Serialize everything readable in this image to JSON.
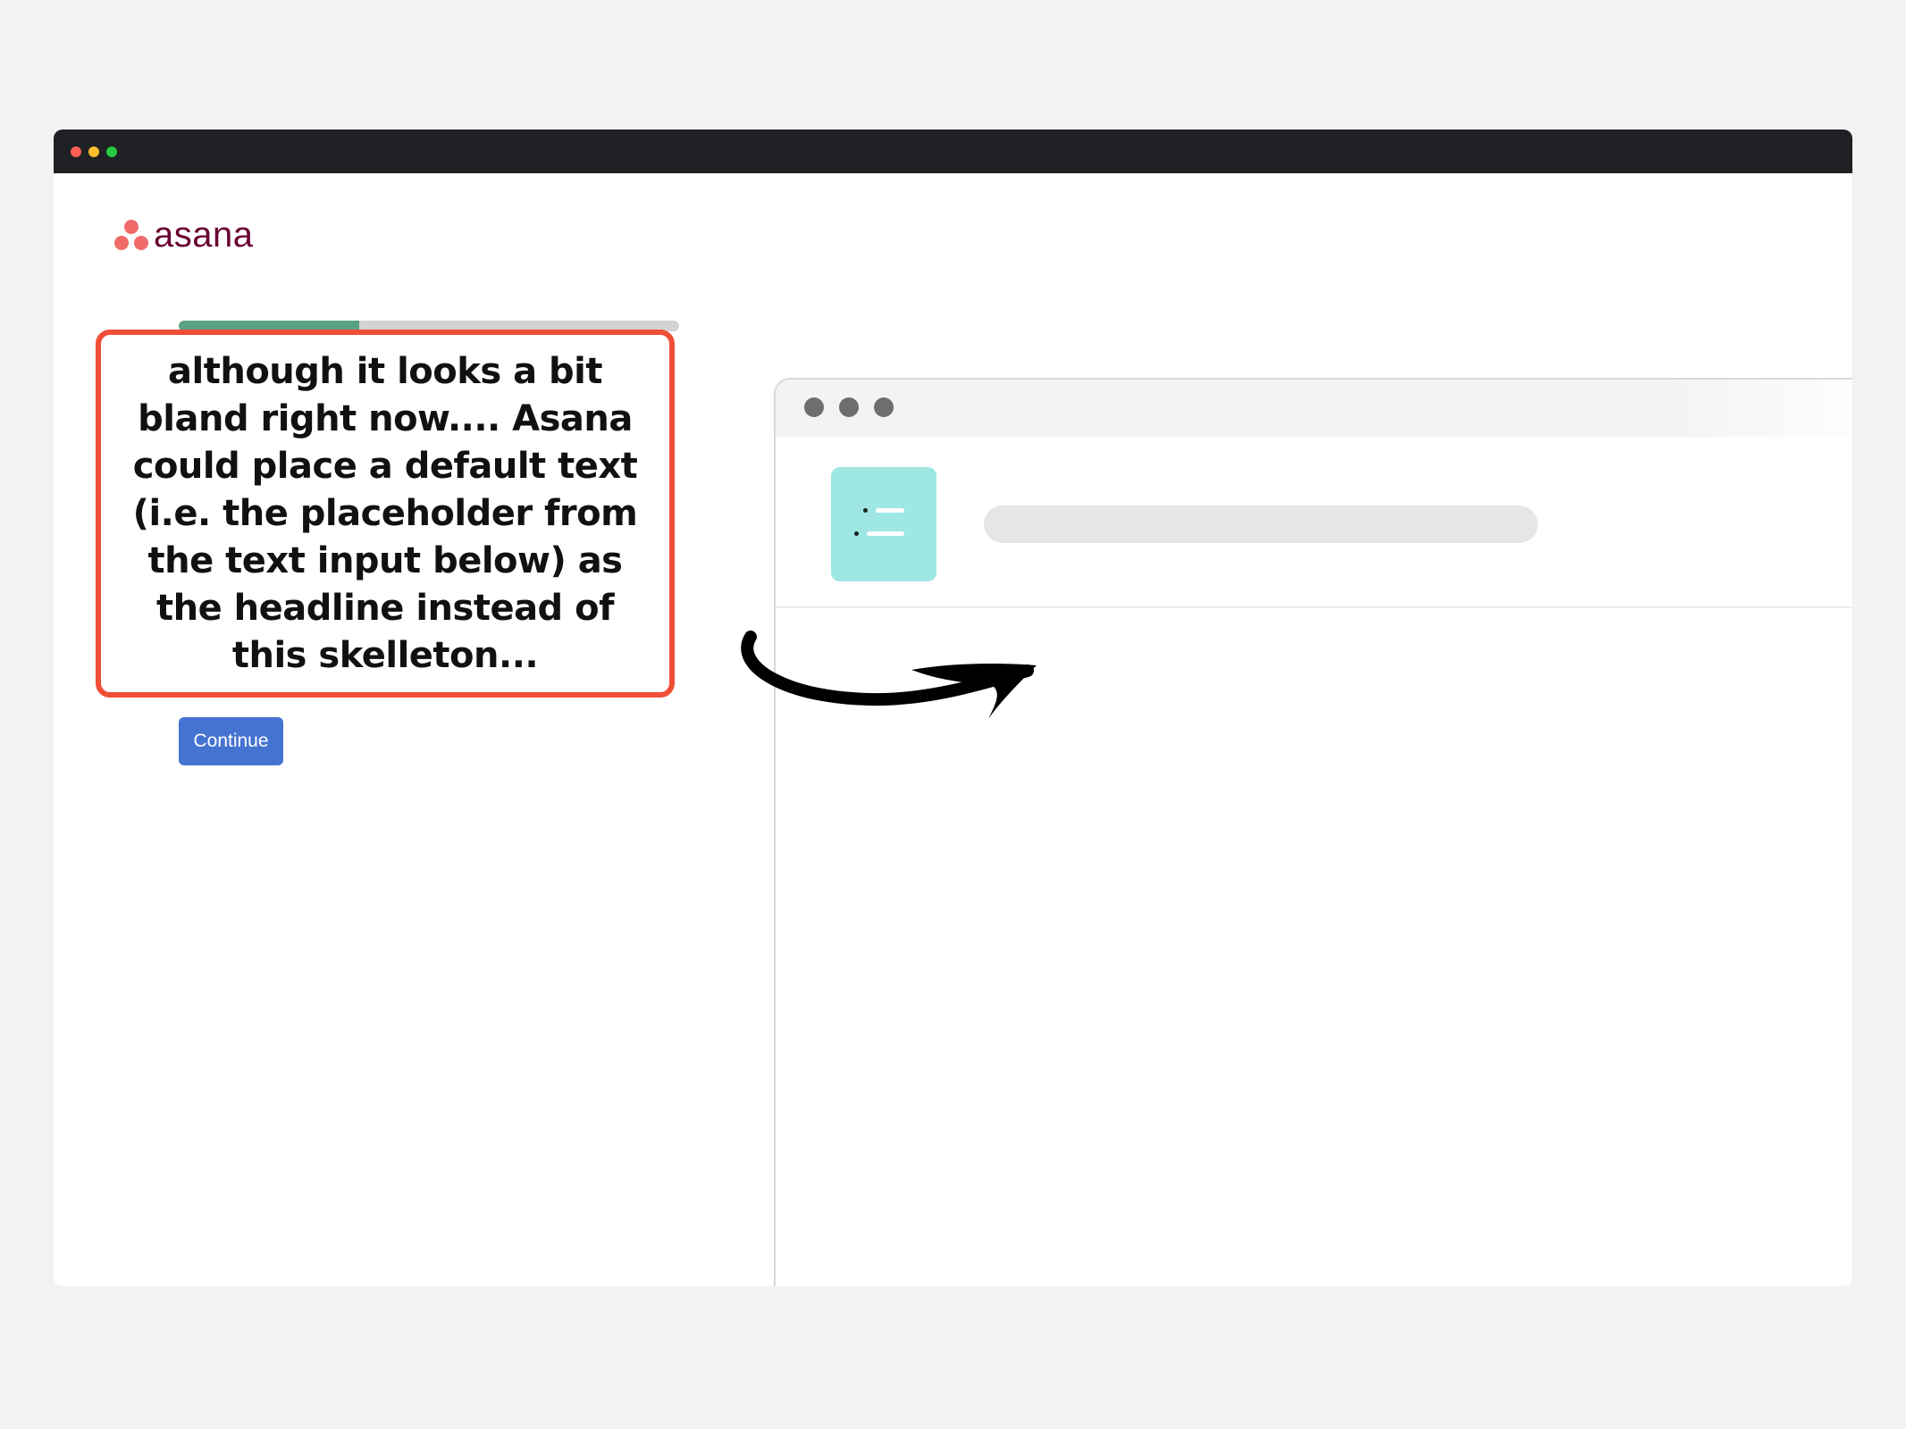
{
  "window": {
    "controls": [
      "close",
      "minimize",
      "maximize"
    ]
  },
  "brand": {
    "name": "asana",
    "color": "#690031",
    "mark_color": "#f06a6a"
  },
  "progress": {
    "fraction": 0.36,
    "fill_color": "#58a182"
  },
  "callout": {
    "text": "although it looks a bit bland right now.... Asana could place a default text (i.e. the placeholder from the text input below)  as the headline instead of this skelleton...",
    "border_color": "#f04e37"
  },
  "form": {
    "continue_label": "Continue",
    "accent": "#4573d2"
  },
  "preview": {
    "tile_color": "#9ee7e3",
    "tile_icon": "list-icon",
    "title_skeleton": "loading-skeleton"
  },
  "annotation": {
    "arrow_icon": "hand-drawn-arrow-icon"
  }
}
